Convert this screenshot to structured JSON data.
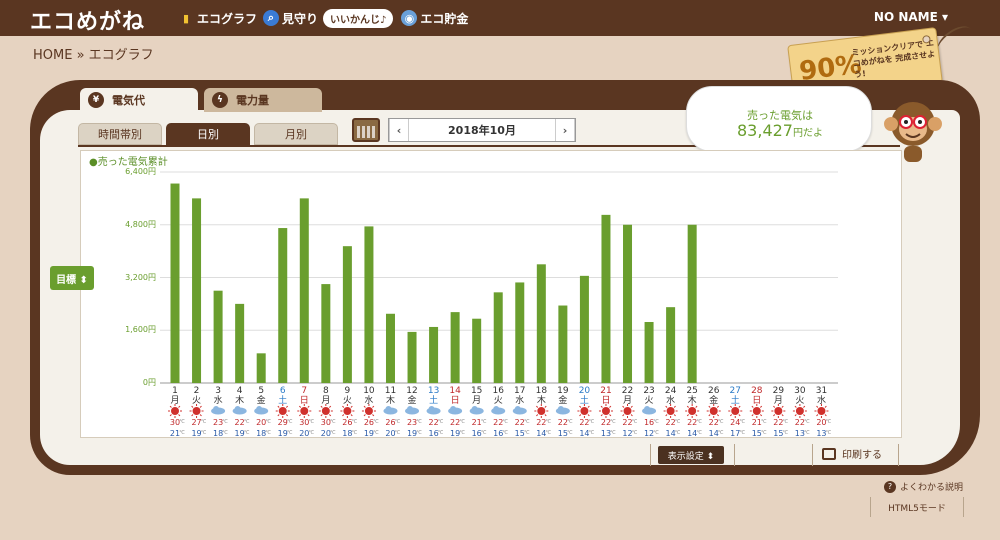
{
  "header": {
    "logo": "エコめがね",
    "nav": [
      {
        "label": "エコグラフ",
        "icon": "bar-chart-icon"
      },
      {
        "label": "見守り",
        "icon": "magnifier-icon"
      },
      {
        "label": "エコ貯金",
        "icon": "coin-icon"
      }
    ],
    "bubble": "いいかんじ♪",
    "user": "NO NAME ▾"
  },
  "breadcrumb": "HOME » エコグラフ",
  "mission": {
    "percent": "90%",
    "text": "ミッションクリアで エコめがねを 完成させよう!"
  },
  "tabs": {
    "electricity_cost": "電気代",
    "electricity_amount": "電力量"
  },
  "subtabs": {
    "hourly": "時間帯別",
    "daily": "日別",
    "monthly": "月別"
  },
  "date": {
    "prev": "‹",
    "value": "2018年10月",
    "next": "›"
  },
  "speech": {
    "line1": "売った電気は",
    "amount": "83,427",
    "suffix": "円だよ"
  },
  "controls": {
    "target": "目標 ⬍",
    "display_settings": "表示設定 ⬍",
    "print": "印刷する",
    "help": "よくわかる説明",
    "html5": "HTML5モード"
  },
  "colors": {
    "brown": "#5a3621",
    "green": "#6a9e2e",
    "sat": "#2a7ac7",
    "sun": "#c0282a"
  },
  "chart_data": {
    "type": "bar",
    "title": "●売った電気累計",
    "ylim": [
      0,
      6400
    ],
    "yticks": [
      "0円",
      "1,600円",
      "3,200円",
      "4,800円",
      "6,400円"
    ],
    "ytick_values": [
      0,
      1600,
      3200,
      4800,
      6400
    ],
    "days": [
      "1",
      "2",
      "3",
      "4",
      "5",
      "6",
      "7",
      "8",
      "9",
      "10",
      "11",
      "12",
      "13",
      "14",
      "15",
      "16",
      "17",
      "18",
      "19",
      "20",
      "21",
      "22",
      "23",
      "24",
      "25",
      "26",
      "27",
      "28",
      "29",
      "30",
      "31"
    ],
    "weekdays": [
      "月",
      "火",
      "水",
      "木",
      "金",
      "土",
      "日",
      "月",
      "火",
      "水",
      "木",
      "金",
      "土",
      "日",
      "月",
      "火",
      "水",
      "木",
      "金",
      "土",
      "日",
      "月",
      "火",
      "水",
      "木",
      "金",
      "土",
      "日",
      "月",
      "火",
      "水"
    ],
    "values": [
      6050,
      5600,
      2800,
      2400,
      900,
      4700,
      5600,
      3000,
      4150,
      4750,
      2100,
      1550,
      1700,
      2150,
      1950,
      2750,
      3050,
      3600,
      2350,
      3250,
      5100,
      4800,
      1850,
      2300,
      4800,
      null,
      null,
      null,
      null,
      null,
      null
    ],
    "weather": [
      "sun",
      "sun",
      "cloud",
      "cloud",
      "cloud",
      "sun",
      "sun",
      "sun",
      "sun",
      "sun",
      "cloud",
      "cloud",
      "cloud",
      "cloud",
      "cloud",
      "cloud",
      "cloud",
      "sun",
      "cloud",
      "sun",
      "sun",
      "sun",
      "cloud",
      "sun",
      "sun",
      "sun",
      "sun",
      "sun",
      "sun",
      "sun",
      "sun"
    ],
    "high": [
      "30",
      "27",
      "23",
      "22",
      "20",
      "29",
      "30",
      "30",
      "26",
      "26",
      "26",
      "23",
      "22",
      "22",
      "21",
      "22",
      "22",
      "22",
      "22",
      "22",
      "22",
      "22",
      "16",
      "22",
      "22",
      "22",
      "24",
      "21",
      "22",
      "22",
      "20"
    ],
    "low": [
      "21",
      "19",
      "18",
      "19",
      "18",
      "19",
      "20",
      "20",
      "18",
      "19",
      "20",
      "19",
      "16",
      "19",
      "16",
      "16",
      "15",
      "14",
      "15",
      "14",
      "13",
      "12",
      "12",
      "14",
      "14",
      "14",
      "17",
      "15",
      "15",
      "13",
      "13"
    ],
    "unit": "℃"
  }
}
